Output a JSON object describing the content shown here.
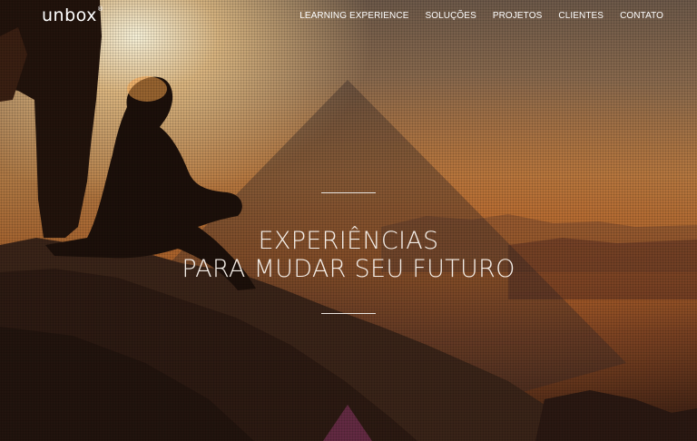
{
  "header": {
    "logo_text": "unbox",
    "nav": [
      {
        "label": "LEARNING EXPERIENCE"
      },
      {
        "label": "SOLUÇÕES"
      },
      {
        "label": "PROJETOS"
      },
      {
        "label": "CLIENTES"
      },
      {
        "label": "CONTATO"
      }
    ]
  },
  "hero": {
    "headline_line1": "EXPERIÊNCIAS",
    "headline_line2": "PARA MUDAR SEU FUTURO",
    "image_description_icon": "hiker-silhouette-photo"
  },
  "colors": {
    "text": "#ffffff",
    "accent_triangle": "#7a3a55"
  }
}
